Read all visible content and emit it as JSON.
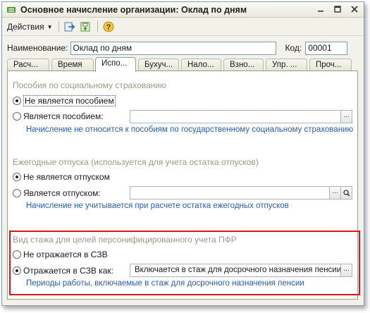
{
  "window": {
    "title": "Основное начисление организации: Оклад по дням"
  },
  "toolbar": {
    "actions_label": "Действия"
  },
  "form": {
    "name_label": "Наименование:",
    "name_value": "Оклад по дням",
    "code_label": "Код:",
    "code_value": "00001"
  },
  "tabs": [
    "Расч...",
    "Время",
    "Испо...",
    "Бухуч...",
    "Нало...",
    "Взно...",
    "Упр. ...",
    "Проч..."
  ],
  "active_tab": "Испо...",
  "sections": {
    "social": {
      "title": "Пособия по социальному страхованию",
      "option_not": "Не является пособием",
      "option_is": "Является пособием:",
      "field_value": "",
      "note": "Начисление не относится к пособиям по государственному социальному страхованию"
    },
    "vacation": {
      "title": "Ежегодные отпуска (используется для учета остатка отпусков)",
      "option_not": "Не является отпуском",
      "option_is": "Является отпуском:",
      "field_value": "",
      "note": "Начисление не учитывается при расчете остатка ежегодных отпусков"
    },
    "pfr": {
      "title": "Вид стажа для целей персонифицированного учета ПФР",
      "option_not": "Не отражается в СЗВ",
      "option_is": "Отражается в СЗВ как:",
      "field_value": "Включается в стаж для досрочного назначения пенсии",
      "note": "Периоды работы, включаемые в стаж для досрочного назначения пенсии"
    }
  },
  "colors": {
    "highlight": "#e0131b",
    "note": "#2a5db0",
    "section_title": "#9a9a84"
  }
}
